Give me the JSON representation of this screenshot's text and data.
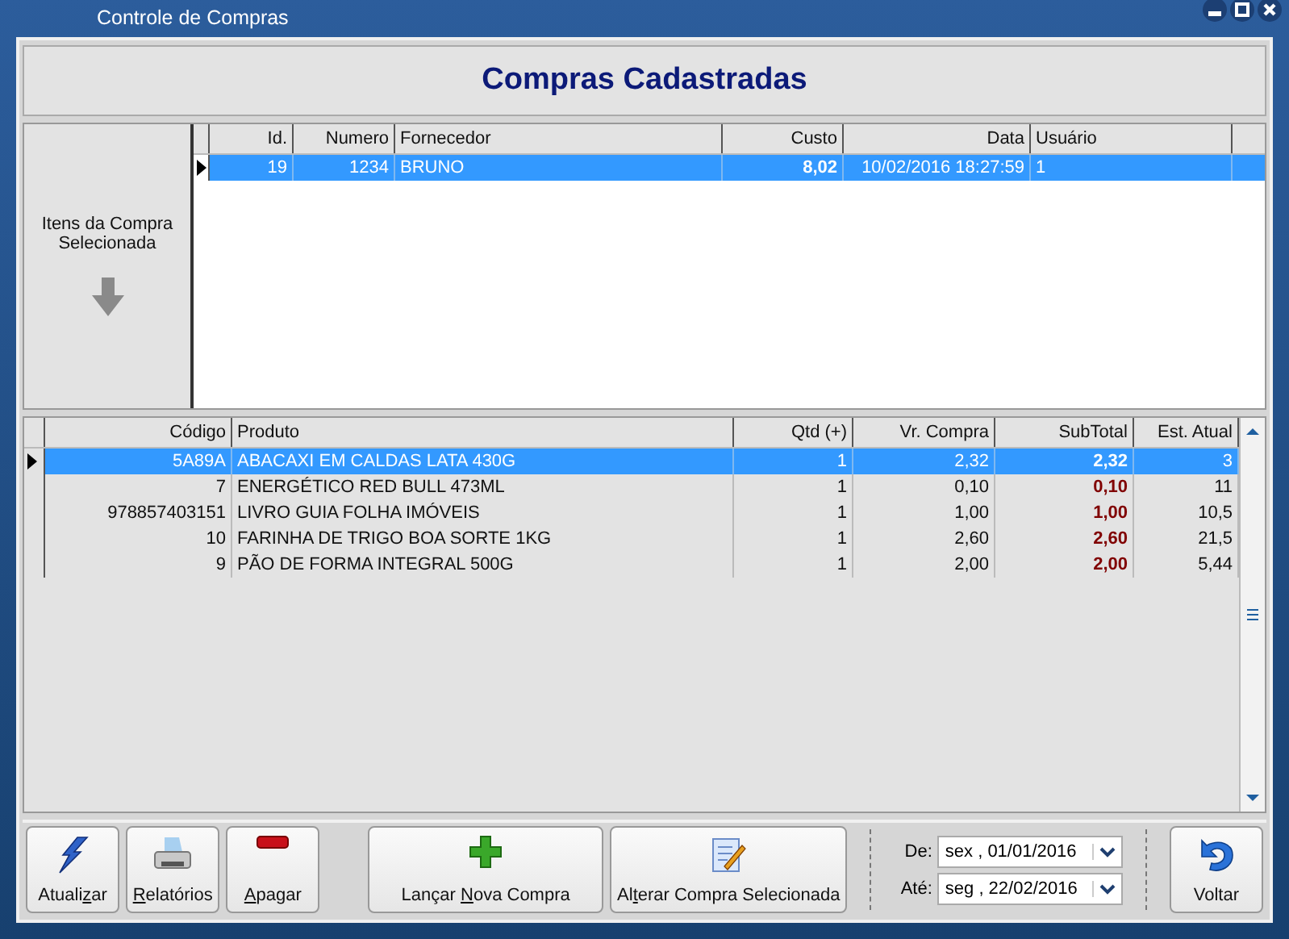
{
  "window": {
    "title": "Controle de Compras"
  },
  "header": {
    "title": "Compras Cadastradas"
  },
  "side_panel": {
    "label": "Itens da Compra Selecionada"
  },
  "purchases": {
    "columns": [
      "Id.",
      "Numero",
      "Fornecedor",
      "Custo",
      "Data",
      "Usuário"
    ],
    "rows": [
      {
        "id": "19",
        "numero": "1234",
        "fornecedor": "BRUNO",
        "custo": "8,02",
        "data": "10/02/2016 18:27:59",
        "usuario": "1",
        "selected": true
      }
    ]
  },
  "items": {
    "columns": [
      "Código",
      "Produto",
      "Qtd (+)",
      "Vr. Compra",
      "SubTotal",
      "Est. Atual"
    ],
    "rows": [
      {
        "codigo": "5A89A",
        "produto": "ABACAXI EM CALDAS LATA 430G",
        "qtd": "1",
        "vr_compra": "2,32",
        "subtotal": "2,32",
        "est_atual": "3",
        "selected": true
      },
      {
        "codigo": "7",
        "produto": "ENERGÉTICO RED BULL 473ML",
        "qtd": "1",
        "vr_compra": "0,10",
        "subtotal": "0,10",
        "est_atual": "11",
        "selected": false
      },
      {
        "codigo": "978857403151",
        "produto": "LIVRO GUIA FOLHA IMÓVEIS",
        "qtd": "1",
        "vr_compra": "1,00",
        "subtotal": "1,00",
        "est_atual": "10,5",
        "selected": false
      },
      {
        "codigo": "10",
        "produto": "FARINHA DE TRIGO BOA SORTE 1KG",
        "qtd": "1",
        "vr_compra": "2,60",
        "subtotal": "2,60",
        "est_atual": "21,5",
        "selected": false
      },
      {
        "codigo": "9",
        "produto": "PÃO DE FORMA INTEGRAL 500G",
        "qtd": "1",
        "vr_compra": "2,00",
        "subtotal": "2,00",
        "est_atual": "5,44",
        "selected": false
      }
    ]
  },
  "toolbar": [
    {
      "kind": "refresh",
      "label": {
        "before": "Atuali",
        "underlined": "z",
        "after": "ar"
      }
    },
    {
      "kind": "print",
      "label": {
        "underlined": "R",
        "after": "elatórios"
      }
    },
    {
      "kind": "delete",
      "label": {
        "underlined": "A",
        "after": "pagar"
      }
    },
    {
      "kind": "add",
      "label": {
        "before": "Lançar ",
        "underlined": "N",
        "after": "ova Compra"
      }
    },
    {
      "kind": "edit",
      "label": {
        "before": "Al",
        "underlined": "t",
        "after": "erar Compra Selecionada"
      }
    }
  ],
  "date_range": [
    {
      "label": "De:",
      "value": "sex , 01/01/2016"
    },
    {
      "label": "Até:",
      "value": "seg , 22/02/2016"
    }
  ],
  "back_button": {
    "label": "Voltar"
  }
}
